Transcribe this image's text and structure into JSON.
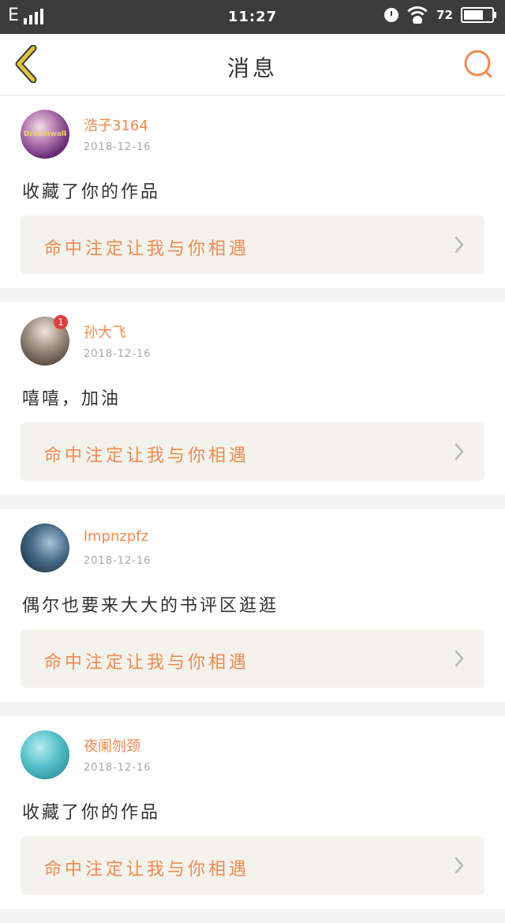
{
  "status_bar": {
    "network": "E",
    "time": "11:27",
    "battery": "72",
    "battery_fraction": 0.72
  },
  "header": {
    "title": "消息",
    "back_icon": "chevron-left-icon",
    "search_icon": "search-icon"
  },
  "colors": {
    "accent": "#f08a4f",
    "back_icon": "#e2c43c",
    "card_bg": "#f3f2ed"
  },
  "messages": [
    {
      "avatar_text": "Dreamwalker",
      "name": "浩子3164",
      "date": "2018-12-16",
      "text": "收藏了你的作品",
      "work_title": "命中注定让我与你相遇"
    },
    {
      "badge": "1",
      "name": "孙大飞",
      "date": "2018-12-16",
      "text": "嘻嘻，加油",
      "work_title": "命中注定让我与你相遇"
    },
    {
      "name": "lmpnzpfz",
      "date": "2018-12-16",
      "text": "偶尔也要来大大的书评区逛逛",
      "work_title": "命中注定让我与你相遇"
    },
    {
      "name": "夜阑刎颈",
      "date": "2018-12-16",
      "text": "收藏了你的作品",
      "work_title": "命中注定让我与你相遇"
    }
  ]
}
